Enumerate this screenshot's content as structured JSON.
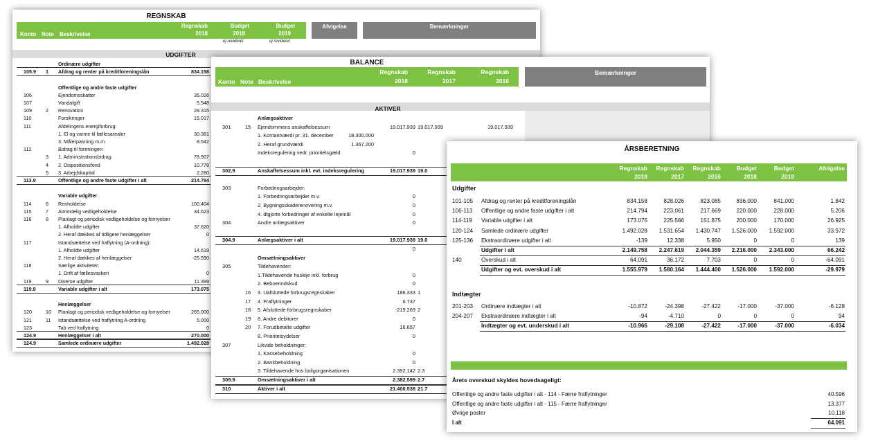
{
  "regnskab": {
    "title": "REGNSKAB",
    "headers": {
      "konto": "Konto",
      "note": "Note",
      "beskrivelse": "Beskrivelse",
      "regnskab": "Regnskab",
      "regnskab_year": "2018",
      "budget1": "Budget",
      "budget1_year": "2018",
      "budget2": "Budget",
      "budget2_year": "2019",
      "afvigelse": "Afvigelse",
      "bemaerkninger": "Bemærkninger",
      "ej1": "ej revideret",
      "ej2": "ej revideret"
    },
    "section": "UDGIFTER",
    "rows": [
      {
        "k": "",
        "n": "",
        "d": "Ordinære udgifter",
        "v": "",
        "b": true
      },
      {
        "k": "105.9",
        "n": "1",
        "d": "Afdrag og renter på kreditforeningslån",
        "v": "834.158",
        "b": true,
        "rule": true
      },
      {
        "k": "",
        "n": "",
        "d": "",
        "v": ""
      },
      {
        "k": "",
        "n": "",
        "d": "Offentlige og andre faste udgifter",
        "v": "",
        "b": true
      },
      {
        "k": "106",
        "n": "",
        "d": "Ejendomsskatter",
        "v": "35.026"
      },
      {
        "k": "107",
        "n": "",
        "d": "Vandafgift",
        "v": "5.548"
      },
      {
        "k": "109",
        "n": "2",
        "d": "Renovation",
        "v": "28.315"
      },
      {
        "k": "110",
        "n": "",
        "d": "Forsikringer",
        "v": "15.017"
      },
      {
        "k": "111",
        "n": "",
        "d": "Afdelingens energiforbrug:",
        "v": ""
      },
      {
        "k": "",
        "n": "",
        "d": "1. El og varme til fællesarealer",
        "v": "30.381"
      },
      {
        "k": "",
        "n": "",
        "d": "3. Målerpasning m.m.",
        "v": "8.542"
      },
      {
        "k": "112",
        "n": "",
        "d": "Bidrag til foreningen:",
        "v": ""
      },
      {
        "k": "",
        "n": "3",
        "d": "1. Administrationsbidrag",
        "v": "78.907"
      },
      {
        "k": "",
        "n": "4",
        "d": "2. Dispositionsfond",
        "v": "10.778"
      },
      {
        "k": "",
        "n": "5",
        "d": "3. Arbejdskapital",
        "v": "2.280"
      },
      {
        "k": "113.9",
        "n": "",
        "d": "Offentlige og andre faste udgifter i alt",
        "v": "214.794",
        "b": true,
        "rule": true
      },
      {
        "k": "",
        "n": "",
        "d": "",
        "v": ""
      },
      {
        "k": "",
        "n": "",
        "d": "Variable udgifter",
        "v": "",
        "b": true
      },
      {
        "k": "114",
        "n": "6",
        "d": "Renholdelse",
        "v": "100.404"
      },
      {
        "k": "115",
        "n": "7",
        "d": "Almindelig vedligeholdelse",
        "v": "34.623"
      },
      {
        "k": "116",
        "n": "8",
        "d": "Planlagt og periodisk vedligeholdelse og fornyelser",
        "v": ""
      },
      {
        "k": "",
        "n": "",
        "d": "1. Afholdte udgifter",
        "v": "37.620"
      },
      {
        "k": "",
        "n": "",
        "d": "2. Heraf dækkes af tidligere henlæggelser",
        "v": "0"
      },
      {
        "k": "117",
        "n": "",
        "d": "Istandsættelse ved fraflytning (A-ordning):",
        "v": ""
      },
      {
        "k": "",
        "n": "",
        "d": "1. Afholdte udgifter",
        "v": "14.619"
      },
      {
        "k": "",
        "n": "",
        "d": "2. Heraf dækkes af henlæggelser",
        "v": "-25.590"
      },
      {
        "k": "118",
        "n": "",
        "d": "Særlige aktiviteter:",
        "v": ""
      },
      {
        "k": "",
        "n": "",
        "d": "1. Drift af fællesvaskeri",
        "v": "0"
      },
      {
        "k": "119",
        "n": "9",
        "d": "Diverse udgifter",
        "v": "11.399"
      },
      {
        "k": "119.9",
        "n": "",
        "d": "Variable udgifter i alt",
        "v": "173.075",
        "b": true,
        "rule": true
      },
      {
        "k": "",
        "n": "",
        "d": "",
        "v": ""
      },
      {
        "k": "",
        "n": "",
        "d": "Henlæggelser",
        "v": "",
        "b": true
      },
      {
        "k": "120",
        "n": "10",
        "d": "Planlagt og periodisk vedligeholdelse og fornyelser",
        "v": "265.000"
      },
      {
        "k": "121",
        "n": "11",
        "d": "Istandsættelse ved fraflytning A-ordning",
        "v": "5.000"
      },
      {
        "k": "123",
        "n": "",
        "d": "Tab ved fraflytning",
        "v": "0"
      },
      {
        "k": "124.9",
        "n": "",
        "d": "Henlæggelser i alt",
        "v": "270.000",
        "b": true,
        "rule": true
      },
      {
        "k": "124.9",
        "n": "",
        "d": "Samlede ordinære udgifter",
        "v": "1.492.028",
        "b": true,
        "rule": true
      }
    ]
  },
  "balance": {
    "title": "BALANCE",
    "headers": {
      "konto": "Konto",
      "note": "Note",
      "beskrivelse": "Beskrivelse",
      "r1": "Regnskab",
      "r1y": "2018",
      "r2": "Regnskab",
      "r2y": "2017",
      "r3": "Regnskab",
      "r3y": "2016",
      "bemaerkninger": "Bemærkninger"
    },
    "section": "AKTIVER",
    "rows": [
      {
        "k": "",
        "n": "",
        "d": "Anlægsaktiver",
        "v": "",
        "b": true
      },
      {
        "k": "301",
        "n": "15",
        "d": "Ejendommens anskaffelsessum",
        "v": "19.017.939",
        "v2": "19.017.939",
        "v3": "19.017.939"
      },
      {
        "k": "",
        "n": "",
        "d": "  1. Kontantværdi pr. 31. december",
        "x": "18.300.000",
        "v": ""
      },
      {
        "k": "",
        "n": "",
        "d": "  2. Heraf grundværdi",
        "x": "1.367.200",
        "v": ""
      },
      {
        "k": "",
        "n": "",
        "d": "Indeksregulering vedr. prioritetsgæld",
        "v": "0"
      },
      {
        "k": "",
        "n": "",
        "d": "",
        "v": ""
      },
      {
        "k": "302.9",
        "n": "",
        "d": "Anskaffelsessum inkl. evt. indeksregulering",
        "v": "19.017.939",
        "v2": "19.0",
        "b": true,
        "rule": true
      },
      {
        "k": "",
        "n": "",
        "d": "",
        "v": ""
      },
      {
        "k": "303",
        "n": "",
        "d": "Forbedringsarbejder:",
        "v": ""
      },
      {
        "k": "",
        "n": "",
        "d": "1. Forbedringsarbejder m.v.",
        "v": "0"
      },
      {
        "k": "",
        "n": "",
        "d": "2. Bygningsskaderenovering m.v.",
        "v": "0"
      },
      {
        "k": "",
        "n": "",
        "d": "4. dtgjorte forbedringer af enkelte lejemål",
        "v": "0"
      },
      {
        "k": "304",
        "n": "",
        "d": "Andre anlægsaktiver",
        "v": "0"
      },
      {
        "k": "",
        "n": "",
        "d": "",
        "v": ""
      },
      {
        "k": "304.9",
        "n": "",
        "d": "Anlægsaktiver i alt",
        "v": "19.017.939",
        "v2": "19.0",
        "b": true,
        "rule": true
      },
      {
        "k": "",
        "n": "",
        "d": "",
        "v": "0"
      },
      {
        "k": "",
        "n": "",
        "d": "Omsætningsaktiver",
        "v": "",
        "b": true
      },
      {
        "k": "305",
        "n": "",
        "d": "Tildehavender:",
        "v": ""
      },
      {
        "k": "",
        "n": "",
        "d": "1.Tildehavende husleje inkl. forbrug",
        "v": "0"
      },
      {
        "k": "",
        "n": "",
        "d": "2. Beboerindskud",
        "v": "0"
      },
      {
        "k": "",
        "n": "16",
        "d": "3. Uafsluttede forbrugsregnskaber",
        "v": "186.333",
        "v2": "1"
      },
      {
        "k": "",
        "n": "17",
        "d": "4. Fraflytninger",
        "v": "6.737"
      },
      {
        "k": "",
        "n": "18",
        "d": "5. Afsluttede forbrugsregnskaber",
        "v": "-219.269",
        "v2": "2"
      },
      {
        "k": "",
        "n": "19",
        "d": "6. Andre debitorer",
        "v": "0"
      },
      {
        "k": "",
        "n": "20",
        "d": "7. Forudbetalte udgifter",
        "v": "16.657"
      },
      {
        "k": "",
        "n": "",
        "d": "8. Prioritetsydelser",
        "v": "0"
      },
      {
        "k": "307",
        "n": "",
        "d": "Likvide beholdninger:",
        "v": ""
      },
      {
        "k": "",
        "n": "",
        "d": "1. Kassebeholdning",
        "v": "0"
      },
      {
        "k": "",
        "n": "",
        "d": "2. Bankbeholdning",
        "v": "0"
      },
      {
        "k": "",
        "n": "",
        "d": "3. Tildehavende hos boligorganisationen",
        "v": "2.392.142",
        "v2": "2.3"
      },
      {
        "k": "309.9",
        "n": "",
        "d": "Omsætningsaktiver i alt",
        "v": "2.382.599",
        "v2": "2.7",
        "b": true,
        "rule": true
      },
      {
        "k": "310",
        "n": "",
        "d": "Aktiver i alt",
        "v": "21.400.538",
        "v2": "21.7",
        "b": true,
        "rule": true
      }
    ]
  },
  "aarsberetning": {
    "title": "ÅRSBERETNING",
    "headers": {
      "h1": "Regnskab",
      "h1y": "2018",
      "h2": "Regnskab",
      "h2y": "2017",
      "h3": "Regnskab",
      "h3y": "2016",
      "h4": "Budget",
      "h4y": "2018",
      "h5": "Budget",
      "h5y": "2019",
      "h6": "Afvigelse"
    },
    "udgifter_label": "Udgifter",
    "udgifter": [
      {
        "k": "101-105",
        "d": "Afdrag og renter på kreditforeningslån",
        "c": [
          "834.158",
          "828.026",
          "823.085",
          "836.000",
          "841.000",
          "1.842"
        ]
      },
      {
        "k": "106-113",
        "d": "Offentlige og andre faste udgifter i alt",
        "c": [
          "214.794",
          "223.061",
          "217.669",
          "220.000",
          "228.000",
          "5.206"
        ]
      },
      {
        "k": "114-119",
        "d": "Variable udgifter i alt",
        "c": [
          "173.075",
          "225.566",
          "151.875",
          "200.000",
          "170.000",
          "26.925"
        ]
      },
      {
        "k": "120-124",
        "d": "Samlede ordinære udgifter",
        "c": [
          "1.492.028",
          "1.531.654",
          "1.430.747",
          "1.526.000",
          "1.592.000",
          "33.972"
        ]
      },
      {
        "k": "125-136",
        "d": "Ekstraordinære udgifter i alt",
        "c": [
          "-139",
          "12.338",
          "5.950",
          "0",
          "0",
          "139"
        ]
      },
      {
        "k": "",
        "d": "Udgifter i alt",
        "c": [
          "2.149.758",
          "2.247.619",
          "2.044.359",
          "2.216.000",
          "2.343.000",
          "66.242"
        ],
        "b": true
      },
      {
        "k": "140",
        "d": "Overskud i alt",
        "c": [
          "64.091",
          "36.172",
          "7.703",
          "0",
          "0",
          "-64.091"
        ]
      },
      {
        "k": "",
        "d": "Udgifter og evt. overskud i alt",
        "c": [
          "1.555.979",
          "1.580.164",
          "1.444.400",
          "1.526.000",
          "1.592.000",
          "-29.979"
        ],
        "b": true
      }
    ],
    "indtaegter_label": "Indtægter",
    "indtaegter": [
      {
        "k": "201-203",
        "d": "Ordinære indtægter i alt",
        "c": [
          "-10.872",
          "-24.398",
          "-27.422",
          "-17.000",
          "-37.000",
          "-6.128"
        ]
      },
      {
        "k": "204-207",
        "d": "Ekstraordinære indtægter i alt",
        "c": [
          "-94",
          "-4.710",
          "0",
          "0",
          "0",
          "94"
        ]
      },
      {
        "k": "",
        "d": "Indtægter og evt. underskud i alt",
        "c": [
          "-10.966",
          "-29.108",
          "-27.422",
          "-17.000",
          "-37.000",
          "-6.034"
        ],
        "b": true
      }
    ],
    "overskud_title": "Årets overskud skyldes hovedsageligt:",
    "overskud": [
      {
        "d": "Offentlige og andre faste udgifter i alt  -  114  -  Færre fraflytninger",
        "v": "40.596"
      },
      {
        "d": "Offentlige og andre faste udgifter i alt  -  115  -  Færre fraflytninger",
        "v": "13.377"
      },
      {
        "d": "Øvrige poster",
        "v": "10.118"
      },
      {
        "d": "I alt",
        "v": "64.091",
        "b": true
      }
    ]
  }
}
